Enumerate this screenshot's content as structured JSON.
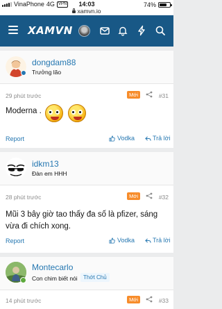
{
  "status_bar": {
    "carrier": "VinaPhone",
    "network": "4G",
    "vpn": "VPN",
    "time": "14:03",
    "url": "xamvn.io",
    "battery": "74%",
    "battery_level": 0.74
  },
  "nav": {
    "logo": "XAMVN",
    "icons": [
      "menu-icon",
      "avatar",
      "mail-icon",
      "bell-icon",
      "bolt-icon",
      "search-icon"
    ]
  },
  "posts": [
    {
      "username": "dongdam88",
      "user_title": "Trưởng lão",
      "time": "29 phút trước",
      "new_label": "Mới",
      "number": "#31",
      "body": "Moderna .",
      "report": "Report",
      "like": "Vodka",
      "reply": "Trả lời"
    },
    {
      "username": "idkm13",
      "user_title": "Đàn em HHH",
      "time": "28 phút trước",
      "new_label": "Mới",
      "number": "#32",
      "body": "Mũi 3 bây giờ tao thấy đa số là pfizer, sáng vừa đi chích xong.",
      "report": "Report",
      "like": "Vodka",
      "reply": "Trả lời"
    },
    {
      "username": "Montecarlo",
      "user_title": "Con chim biết nói",
      "badge": "Thớt Chủ",
      "time": "14 phút trước",
      "new_label": "Mới",
      "number": "#33"
    }
  ],
  "colors": {
    "nav_bg": "#185886",
    "link": "#2577b1",
    "new_badge": "#f78c2a",
    "page_bg": "#ebeced"
  }
}
